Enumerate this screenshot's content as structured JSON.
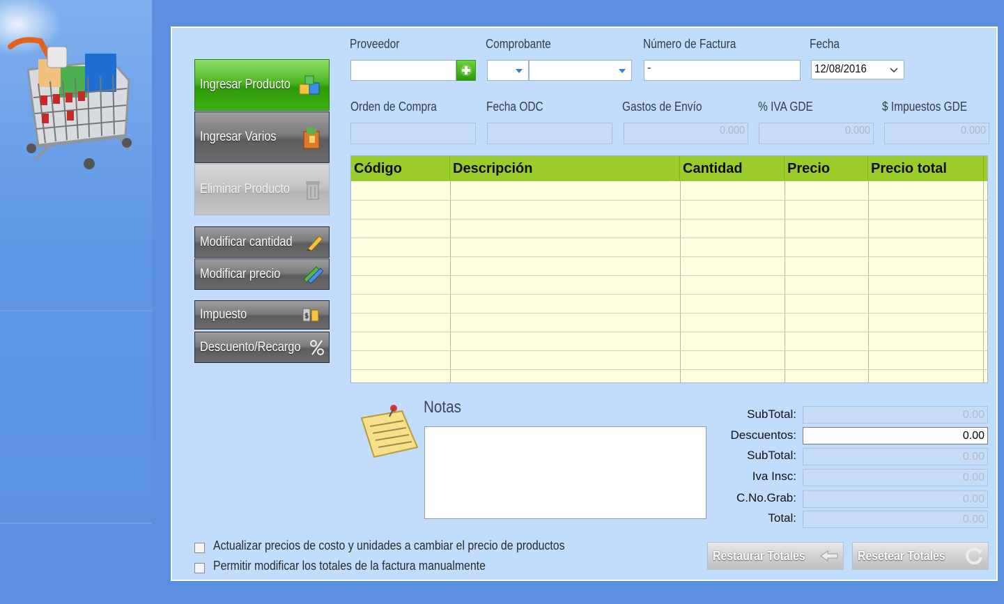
{
  "header": {
    "proveedor_label": "Proveedor",
    "comprobante_label": "Comprobante",
    "numero_factura_label": "Número de Factura",
    "numero_factura_value": "-",
    "fecha_label": "Fecha",
    "fecha_value": "12/08/2016",
    "orden_compra_label": "Orden de Compra",
    "fecha_odc_label": "Fecha ODC",
    "gastos_envio_label": "Gastos de Envío",
    "gastos_envio_value": "0.000",
    "iva_gde_label": "% IVA GDE",
    "iva_gde_value": "0.000",
    "impuestos_gde_label": "$ Impuestos GDE",
    "impuestos_gde_value": "0.000"
  },
  "actions": {
    "ingresar_producto": "Ingresar Producto",
    "ingresar_varios": "Ingresar Varios",
    "eliminar_producto": "Eliminar Producto",
    "modificar_cantidad": "Modificar cantidad",
    "modificar_precio": "Modificar precio",
    "impuesto": "Impuesto",
    "descuento_recargo": "Descuento/Recargo"
  },
  "table": {
    "columns": [
      "Código",
      "Descripción",
      "Cantidad",
      "Precio",
      "Precio total"
    ],
    "rows": []
  },
  "notes": {
    "label": "Notas"
  },
  "totals": {
    "subtotal1_label": "SubTotal:",
    "subtotal1_value": "0.00",
    "descuentos_label": "Descuentos:",
    "descuentos_value": "0.00",
    "subtotal2_label": "SubTotal:",
    "subtotal2_value": "0.00",
    "iva_label": "Iva Insc:",
    "iva_value": "0.00",
    "cnograb_label": "C.No.Grab:",
    "cnograb_value": "0.00",
    "total_label": "Total:",
    "total_value": "0.00"
  },
  "options": {
    "actualizar_precios": "Actualizar precios de costo y unidades a cambiar el precio de productos",
    "permitir_modificar": "Permitir modificar los totales de la factura manualmente"
  },
  "footer_buttons": {
    "restaurar": "Restaurar Totales",
    "resetear": "Resetear Totales"
  },
  "colors": {
    "background": "#5b8fe0",
    "panel": "#c2dcfb",
    "grid_header": "#9ccc2c",
    "grid_body": "#ffffe1",
    "primary_button": "#3caf14"
  }
}
